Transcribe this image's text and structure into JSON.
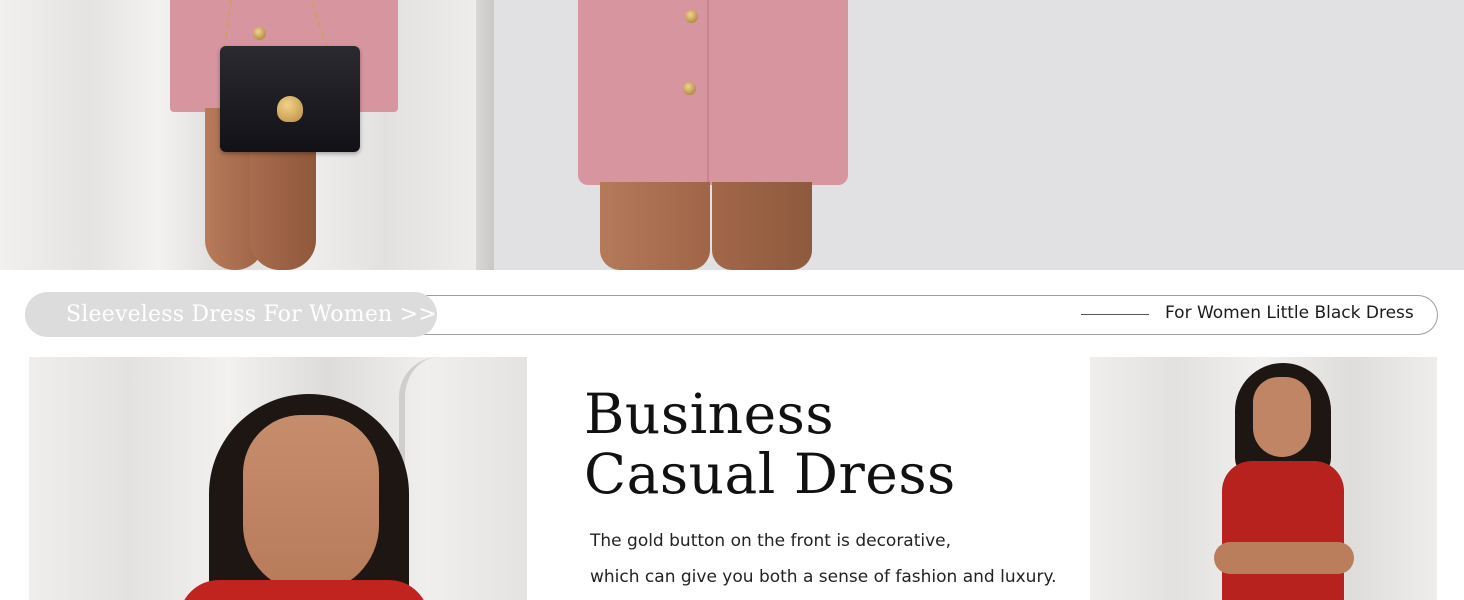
{
  "nav": {
    "left_label": "Sleeveless Dress For Women >>",
    "right_label": "For Women Little Black Dress"
  },
  "content": {
    "headline_line1": "Business",
    "headline_line2": "Casual Dress",
    "description_line1": "The gold button on the front is decorative,",
    "description_line2": "which can give you both a sense of fashion and luxury."
  },
  "colors": {
    "pink_skirt": "#d7959f",
    "red_dress": "#c1231f",
    "pill_background": "#dcdcdd",
    "gold_button": "#c9a35c"
  }
}
